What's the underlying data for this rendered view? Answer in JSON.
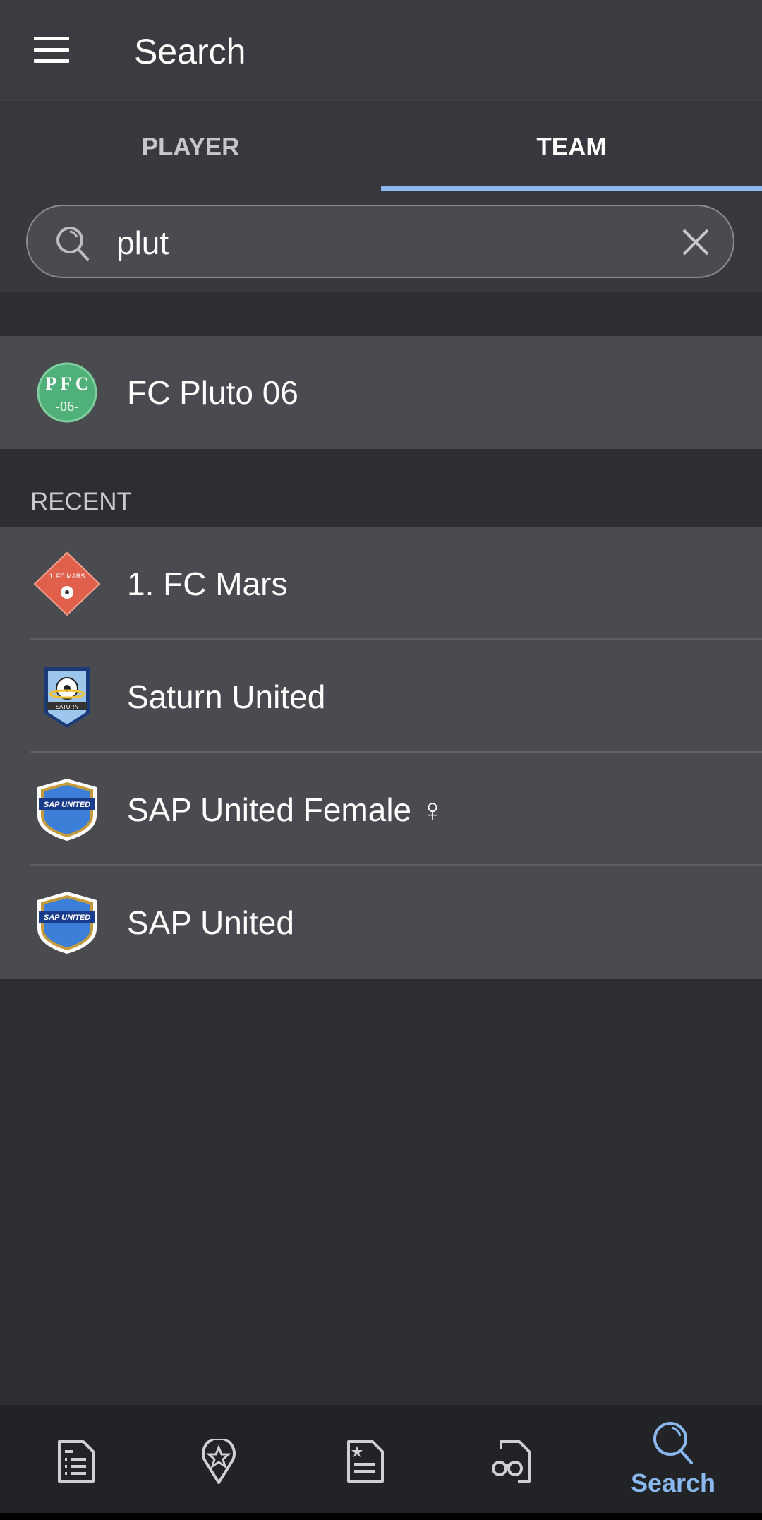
{
  "header": {
    "title": "Search",
    "menu_icon": "hamburger-menu-icon"
  },
  "tabs": [
    {
      "label": "PLAYER",
      "active": false
    },
    {
      "label": "TEAM",
      "active": true
    }
  ],
  "search": {
    "value": "plut",
    "placeholder": "",
    "search_icon": "search-icon",
    "clear_icon": "close-icon"
  },
  "results": [
    {
      "name": "FC Pluto 06",
      "logo": "fc-pluto-06-crest"
    }
  ],
  "recent": {
    "label": "RECENT",
    "items": [
      {
        "name": "1. FC Mars",
        "logo": "fc-mars-crest"
      },
      {
        "name": "Saturn United",
        "logo": "saturn-united-crest"
      },
      {
        "name": "SAP United Female ♀",
        "logo": "sap-united-crest"
      },
      {
        "name": "SAP United",
        "logo": "sap-united-crest"
      }
    ]
  },
  "bottom_nav": {
    "items": [
      {
        "icon": "list-document-icon",
        "label": ""
      },
      {
        "icon": "location-star-icon",
        "label": ""
      },
      {
        "icon": "starred-document-icon",
        "label": ""
      },
      {
        "icon": "binoculars-document-icon",
        "label": ""
      },
      {
        "icon": "search-icon",
        "label": "Search",
        "active": true
      }
    ]
  },
  "colors": {
    "accent": "#8ab8ee",
    "pluto_green": "#4fb07a",
    "mars_red": "#e0604c",
    "sap_blue": "#3b7fd8"
  }
}
